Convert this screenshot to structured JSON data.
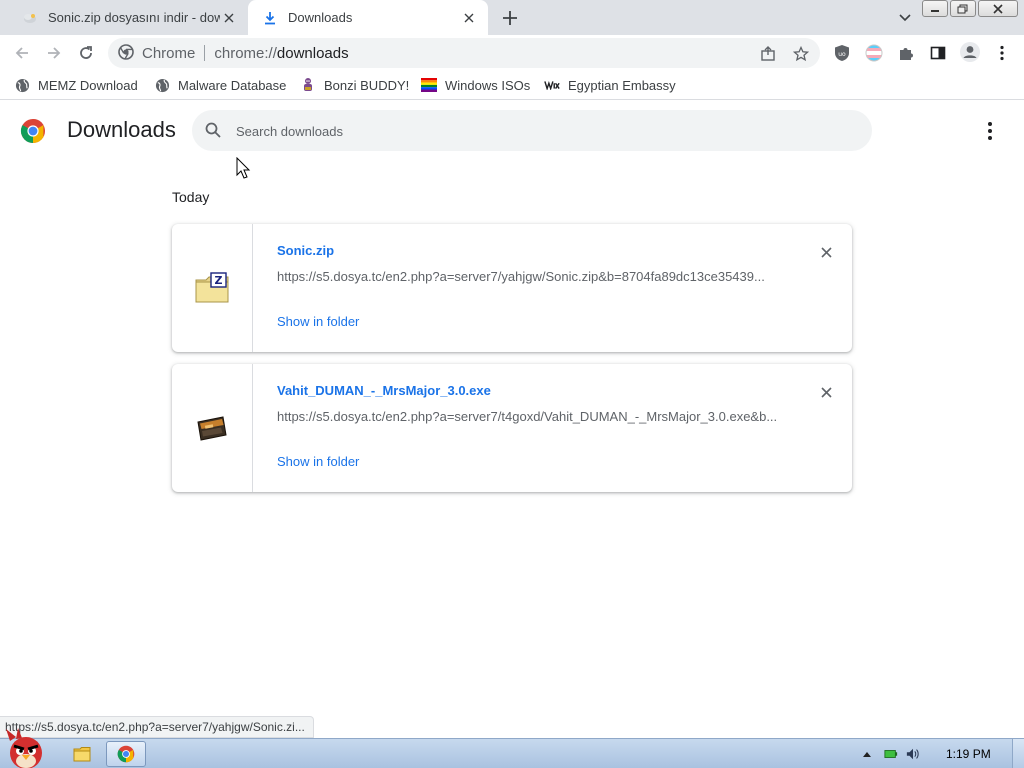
{
  "tabs": [
    {
      "title": "Sonic.zip dosyasını indir - dow",
      "active": false,
      "favicon": "sonic-favicon-icon"
    },
    {
      "title": "Downloads",
      "active": true,
      "favicon": "download-icon"
    }
  ],
  "toolbar": {
    "site_label": "Chrome",
    "url_scheme": "chrome://",
    "url_host": "downloads"
  },
  "bookmarks": [
    {
      "label": "MEMZ Download",
      "icon": "globe-icon"
    },
    {
      "label": "Malware Database",
      "icon": "globe-icon"
    },
    {
      "label": "Bonzi BUDDY!",
      "icon": "bonzi-icon"
    },
    {
      "label": "Windows ISOs",
      "icon": "rainbow-flag-icon"
    },
    {
      "label": "Egyptian Embassy",
      "icon": "wix-icon"
    }
  ],
  "downloads_page": {
    "title": "Downloads",
    "search_placeholder": "Search downloads",
    "date_group": "Today",
    "items": [
      {
        "name": "Sonic.zip",
        "url": "https://s5.dosya.tc/en2.php?a=server7/yahjgw/Sonic.zip&b=8704fa89dc13ce35439...",
        "action": "Show in folder",
        "icon": "zip-folder-icon"
      },
      {
        "name": "Vahit_DUMAN_-_MrsMajor_3.0.exe",
        "url": "https://s5.dosya.tc/en2.php?a=server7/t4goxd/Vahit_DUMAN_-_MrsMajor_3.0.exe&b...",
        "action": "Show in folder",
        "icon": "exe-file-icon"
      }
    ]
  },
  "status_bar": {
    "text": "https://s5.dosya.tc/en2.php?a=server7/yahjgw/Sonic.zi..."
  },
  "taskbar": {
    "time": "1:19 PM"
  },
  "colors": {
    "accent": "#1a73e8",
    "tabstrip": "#dee1e6",
    "omnibox": "#f1f3f4"
  }
}
